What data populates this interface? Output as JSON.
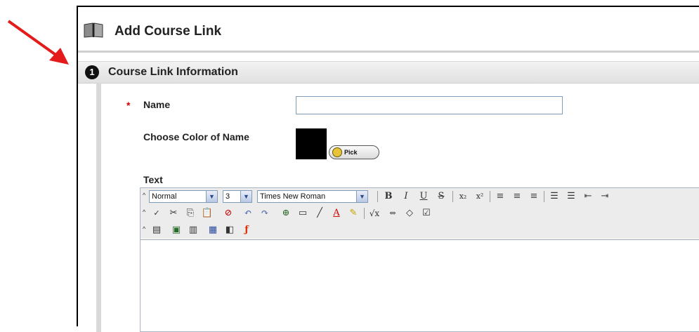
{
  "page": {
    "title": "Add Course Link",
    "section_number": "1",
    "section_title": "Course Link Information"
  },
  "form": {
    "name_label": "Name",
    "name_value": "",
    "required_marker": "*",
    "color_label": "Choose Color of Name",
    "swatch_color": "#000000",
    "pick_label": "Pick",
    "text_label": "Text"
  },
  "editor": {
    "format_value": "Normal",
    "size_value": "3",
    "font_value": "Times New Roman",
    "buttons": {
      "bold": "B",
      "italic": "I",
      "underline": "U",
      "strike": "S"
    }
  },
  "colors": {
    "annotation_arrow": "#e31b1b",
    "section_bar": "#e6e6e6",
    "required": "#d40000"
  }
}
